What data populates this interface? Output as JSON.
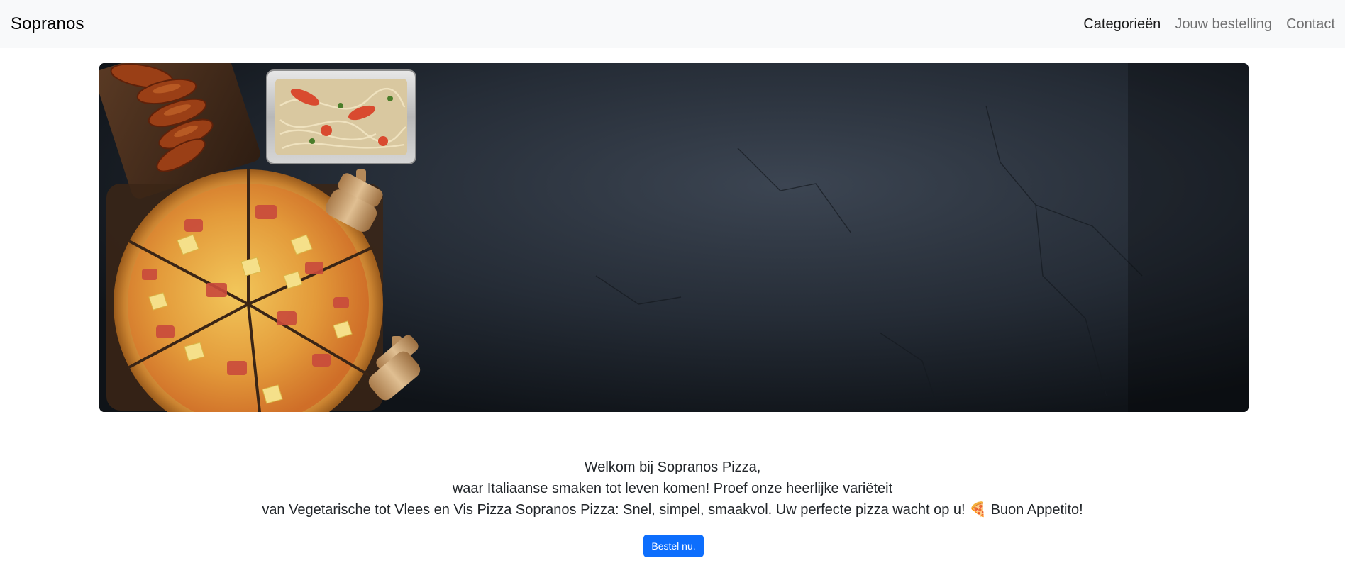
{
  "navbar": {
    "brand": "Sopranos",
    "links": [
      {
        "label": "Categorieën",
        "active": true
      },
      {
        "label": "Jouw bestelling",
        "active": false
      },
      {
        "label": "Contact",
        "active": false
      }
    ]
  },
  "welcome": {
    "line1": "Welkom bij Sopranos Pizza,",
    "line2": "waar Italiaanse smaken tot leven komen! Proef onze heerlijke variëteit",
    "line3": "van Vegetarische tot Vlees en Vis Pizza Sopranos Pizza: Snel, simpel, smaakvol. Uw perfecte pizza wacht op u! 🍕 Buon Appetito!"
  },
  "cta": {
    "label": "Bestel nu."
  },
  "colors": {
    "primary": "#0d6efd",
    "navbar_bg": "#f8f9fa"
  }
}
